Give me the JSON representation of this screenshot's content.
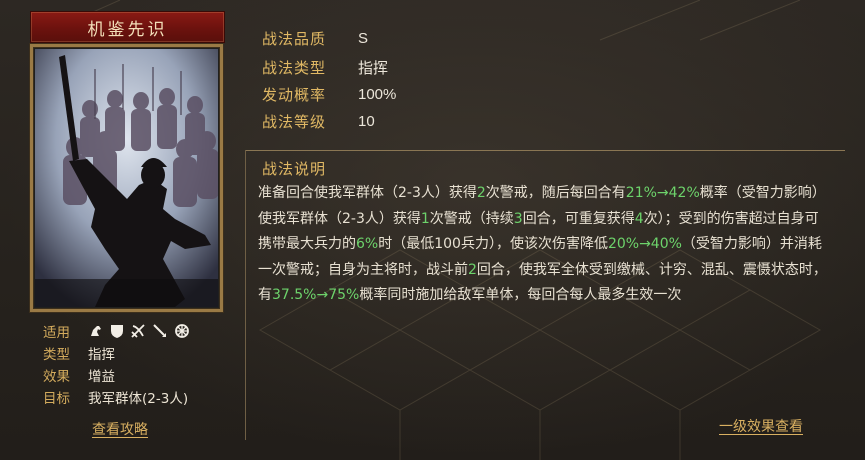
{
  "card": {
    "title": "机鉴先识"
  },
  "attributes": {
    "applicable_label": "适用",
    "applicable_icons": [
      "cavalry-icon",
      "shield-icon",
      "bow-icon",
      "spear-icon",
      "chariot-icon"
    ],
    "type_label": "类型",
    "type_value": "指挥",
    "effect_label": "效果",
    "effect_value": "增益",
    "target_label": "目标",
    "target_value": "我军群体(2-3人)"
  },
  "links": {
    "strategy": "查看攻略",
    "level_one": "一级效果查看"
  },
  "info": {
    "quality_label": "战法品质",
    "quality_value": "S",
    "type_label": "战法类型",
    "type_value": "指挥",
    "rate_label": "发动概率",
    "rate_value": "100%",
    "level_label": "战法等级",
    "level_value": "10"
  },
  "description": {
    "title": "战法说明",
    "segments": [
      {
        "text": "准备回合使我军群体（2-3人）获得"
      },
      {
        "text": "2",
        "highlight": true
      },
      {
        "text": "次警戒，随后每回合有"
      },
      {
        "text": "21%→42%",
        "highlight": true
      },
      {
        "text": "概率（受智力影响）使我军群体（2-3人）获得"
      },
      {
        "text": "1",
        "highlight": true
      },
      {
        "text": "次警戒（持续"
      },
      {
        "text": "3",
        "highlight": true
      },
      {
        "text": "回合，可重复获得"
      },
      {
        "text": "4",
        "highlight": true
      },
      {
        "text": "次）；受到的伤害超过自身可携带最大兵力的"
      },
      {
        "text": "6%",
        "highlight": true
      },
      {
        "text": "时（最低100兵力），使该次伤害降低"
      },
      {
        "text": "20%→40%",
        "highlight": true
      },
      {
        "text": "（受智力影响）并消耗一次警戒；自身为主将时，战斗前"
      },
      {
        "text": "2",
        "highlight": true
      },
      {
        "text": "回合，使我军全体受到缴械、计穷、混乱、震慑状态时，有"
      },
      {
        "text": "37.5%→75%",
        "highlight": true
      },
      {
        "text": "概率同时施加给敌军单体，每回合每人最多生效一次"
      }
    ]
  },
  "colors": {
    "highlight": "#6dd36b",
    "gold": "#e0b864",
    "title_bar": "#7a1610"
  }
}
